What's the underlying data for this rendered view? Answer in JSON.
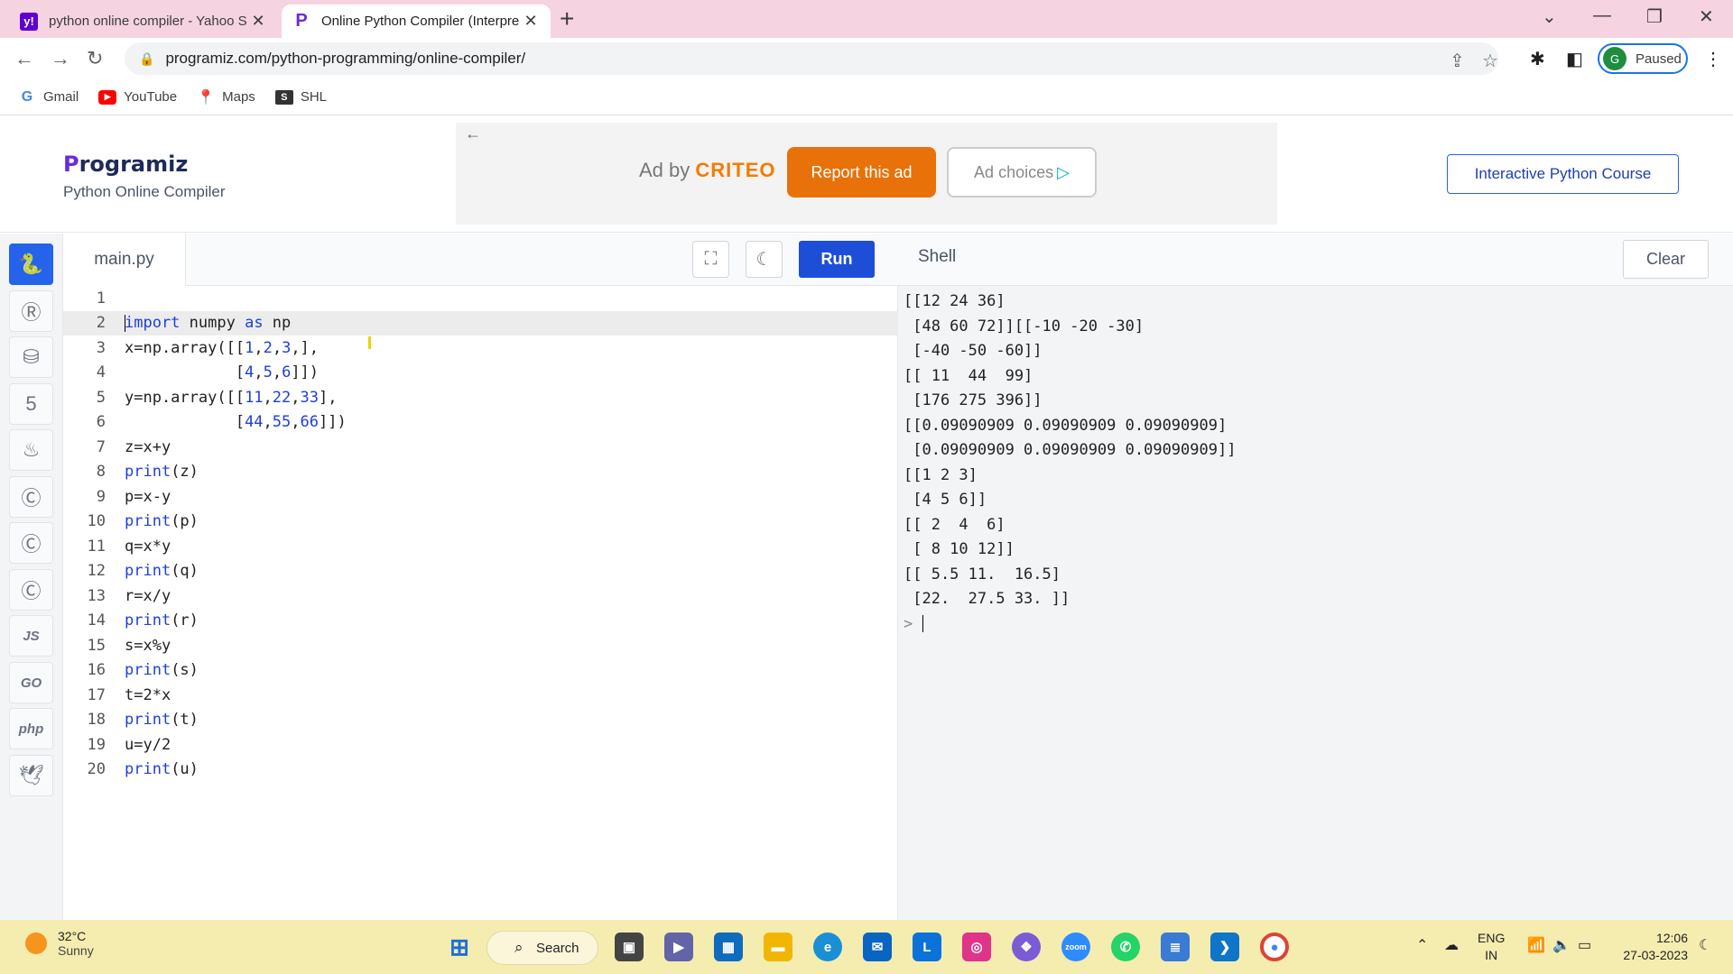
{
  "browser": {
    "tabs": [
      {
        "title": "python online compiler - Yahoo S",
        "favicon": "yahoo-icon",
        "active": false
      },
      {
        "title": "Online Python Compiler (Interpre",
        "favicon": "programiz-icon",
        "active": true
      }
    ],
    "url": "programiz.com/python-programming/online-compiler/",
    "profile": {
      "initial": "G",
      "status": "Paused"
    },
    "bookmarks": [
      {
        "label": "Gmail",
        "icon": "google-icon"
      },
      {
        "label": "YouTube",
        "icon": "youtube-icon"
      },
      {
        "label": "Maps",
        "icon": "maps-icon"
      },
      {
        "label": "SHL",
        "icon": "shl-icon"
      }
    ]
  },
  "header": {
    "logo": "rogramiz",
    "logo_initial": "P",
    "subtitle": "Python Online Compiler",
    "ad": {
      "prefix": "Ad by",
      "brand": "CRITEO",
      "report": "Report this ad",
      "choices": "Ad choices"
    },
    "course_button": "Interactive Python Course"
  },
  "languages": [
    "python",
    "r",
    "sql",
    "html",
    "java",
    "c",
    "cpp",
    "csharp",
    "JS",
    "GO",
    "php",
    "swift"
  ],
  "editor": {
    "filename": "main.py",
    "run_label": "Run",
    "lines": [
      "",
      "import numpy as np",
      "x=np.array([[1,2,3,],",
      "            [4,5,6]])",
      "y=np.array([[11,22,33],",
      "            [44,55,66]])",
      "z=x+y",
      "print(z)",
      "p=x-y",
      "print(p)",
      "q=x*y",
      "print(q)",
      "r=x/y",
      "print(r)",
      "s=x%y",
      "print(s)",
      "t=2*x",
      "print(t)",
      "u=y/2",
      "print(u)"
    ]
  },
  "shell": {
    "title": "Shell",
    "clear_label": "Clear",
    "output": [
      "[[12 24 36]",
      " [48 60 72]][[-10 -20 -30]",
      " [-40 -50 -60]]",
      "[[ 11  44  99]",
      " [176 275 396]]",
      "[[0.09090909 0.09090909 0.09090909]",
      " [0.09090909 0.09090909 0.09090909]]",
      "[[1 2 3]",
      " [4 5 6]]",
      "[[ 2  4  6]",
      " [ 8 10 12]]",
      "[[ 5.5 11.  16.5]",
      " [22.  27.5 33. ]]"
    ],
    "prompt": ">"
  },
  "taskbar": {
    "weather": {
      "temp": "32°C",
      "condition": "Sunny"
    },
    "search_label": "Search",
    "language": {
      "line1": "ENG",
      "line2": "IN"
    },
    "clock": {
      "time": "12:06",
      "date": "27-03-2023"
    }
  }
}
